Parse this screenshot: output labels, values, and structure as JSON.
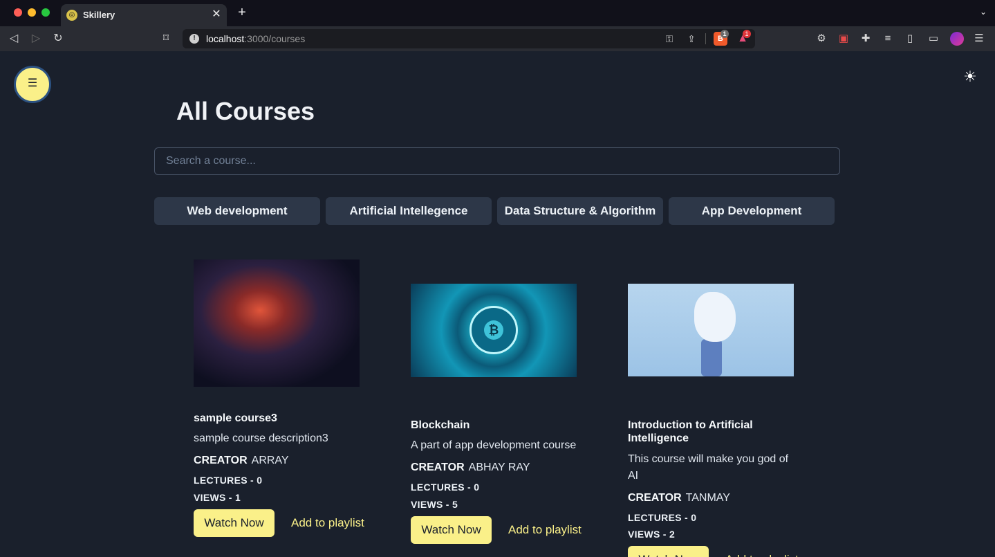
{
  "browser": {
    "tab_title": "Skillery",
    "tab_close": "✕",
    "new_tab": "+",
    "tabs_menu": "⌄",
    "url_host": "localhost",
    "url_path": ":3000/courses",
    "brave_badge": "1",
    "rewards_badge": "1",
    "traffic_colors": [
      "#ff5f57",
      "#febc2e",
      "#28c840"
    ]
  },
  "page": {
    "menu_icon": "☰",
    "theme_icon": "☀",
    "title": "All Courses",
    "search_placeholder": "Search a course..."
  },
  "categories": [
    "Web development",
    "Artificial Intellegence",
    "Data Structure & Algorithm",
    "App Development"
  ],
  "courses": [
    {
      "title": "sample course3",
      "description": "sample course description3",
      "creator_label": "CREATOR",
      "creator": "ARRAY",
      "lectures": "LECTURES - 0",
      "views": "VIEWS - 1",
      "watch_label": "Watch Now",
      "playlist_label": "Add to playlist"
    },
    {
      "title": "Blockchain",
      "description": "A part of app development course",
      "creator_label": "CREATOR",
      "creator": "ABHAY RAY",
      "lectures": "LECTURES - 0",
      "views": "VIEWS - 5",
      "watch_label": "Watch Now",
      "playlist_label": "Add to playlist",
      "coin_symbol": "₿"
    },
    {
      "title": "Introduction to Artificial Intelligence",
      "description": "This course will make you god of AI",
      "creator_label": "CREATOR",
      "creator": "TANMAY",
      "lectures": "LECTURES - 0",
      "views": "VIEWS - 2",
      "watch_label": "Watch Now",
      "playlist_label": "Add to playlist"
    }
  ],
  "colors": {
    "background": "#1a202c",
    "accent_yellow": "#faf089",
    "category_bg": "#2d3748"
  }
}
